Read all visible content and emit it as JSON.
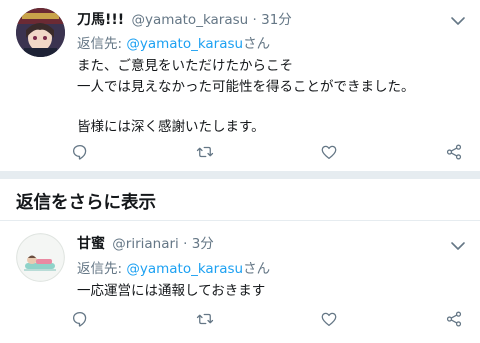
{
  "tweet1": {
    "display_name": "刀馬!!!",
    "handle": "@yamato_karasu",
    "separator_dot": "·",
    "time": "31分",
    "reply_prefix": "返信先: ",
    "reply_mention": "@yamato_karasu",
    "reply_suffix": "さん",
    "lines": [
      "また、ご意見をいただけたからこそ",
      "一人では見えなかった可能性を得ることができました。",
      "皆様には深く感謝いたします。"
    ]
  },
  "more_replies": {
    "label": "返信をさらに表示"
  },
  "tweet2": {
    "display_name": "甘蜜",
    "handle": "@ririanari",
    "separator_dot": "·",
    "time": "3分",
    "reply_prefix": "返信先: ",
    "reply_mention": "@yamato_karasu",
    "reply_suffix": "さん",
    "lines": [
      "一応運営には通報しておきます"
    ]
  },
  "icons": {
    "reply": "reply-icon",
    "retweet": "retweet-icon",
    "like": "heart-icon",
    "share": "share-icon",
    "menu": "chevron-down-icon"
  },
  "colors": {
    "link": "#1da1f2",
    "secondary_text": "#657786",
    "icon": "#657786",
    "separator": "#e6ecf0"
  }
}
